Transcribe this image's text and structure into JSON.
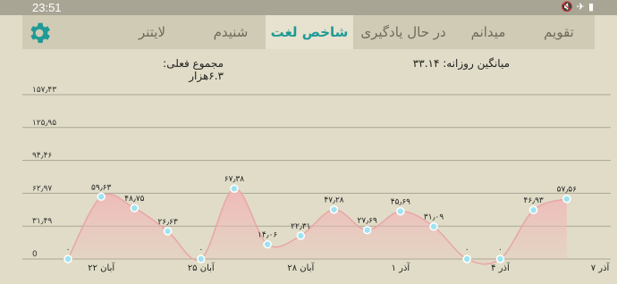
{
  "status": {
    "time": "23:51",
    "icons": [
      "mute-icon",
      "airplane-icon",
      "battery-icon"
    ],
    "icon_glyphs": "🔇✈▮"
  },
  "tabs": [
    {
      "label": "تقویم"
    },
    {
      "label": "میدانم"
    },
    {
      "label": "در حال یادگیری"
    },
    {
      "label": "شاخص لغت"
    },
    {
      "label": "شنیدم"
    },
    {
      "label": "لایتنر"
    }
  ],
  "summary": {
    "daily_average": "میانگین روزانه: ۳۳.۱۴",
    "total": "مجموع فعلی: ۶.۳هزار"
  },
  "colors": {
    "accent": "#1f9a96",
    "line": "#e8a6a6",
    "fill": "#f0b8b8",
    "point": "#9fe3f2",
    "point_stroke": "#ffffff"
  },
  "chart_data": {
    "type": "area",
    "y_ticks": [
      "0",
      "۳۱٫۴۹",
      "۶۲٫۹۷",
      "۹۴٫۴۶",
      "۱۲۵٫۹۵",
      "۱۵۷٫۴۳"
    ],
    "y_tick_values": [
      0,
      31.49,
      62.97,
      94.46,
      125.95,
      157.43
    ],
    "ylim": [
      0,
      157.43
    ],
    "x_ticks": [
      {
        "label": "۲۲ آبان",
        "x": 2
      },
      {
        "label": "۲۵ آبان",
        "x": 5
      },
      {
        "label": "۲۸ آبان",
        "x": 8
      },
      {
        "label": "۱ آذر",
        "x": 11
      },
      {
        "label": "۴ آذر",
        "x": 14
      },
      {
        "label": "۷ آذر",
        "x": 17
      }
    ],
    "xlim": [
      1,
      17
    ],
    "points": [
      {
        "x": 1,
        "y": 0,
        "label": "۰"
      },
      {
        "x": 2,
        "y": 59.63,
        "label": "۵۹٫۶۳"
      },
      {
        "x": 3,
        "y": 48.75,
        "label": "۴۸٫۷۵"
      },
      {
        "x": 4,
        "y": 26.63,
        "label": "۲۶٫۶۳"
      },
      {
        "x": 5,
        "y": 0,
        "label": "۰"
      },
      {
        "x": 6,
        "y": 67.38,
        "label": "۶۷٫۳۸"
      },
      {
        "x": 7,
        "y": 14.06,
        "label": "۱۴٫۰۶"
      },
      {
        "x": 8,
        "y": 22.31,
        "label": "۲۲٫۳۱"
      },
      {
        "x": 9,
        "y": 47.28,
        "label": "۴۷٫۲۸"
      },
      {
        "x": 10,
        "y": 27.69,
        "label": "۲۷٫۶۹"
      },
      {
        "x": 11,
        "y": 45.69,
        "label": "۴۵٫۶۹"
      },
      {
        "x": 12,
        "y": 31.09,
        "label": "۳۱٫۰۹"
      },
      {
        "x": 13,
        "y": 0,
        "label": "۰"
      },
      {
        "x": 14,
        "y": 0,
        "label": "۰"
      },
      {
        "x": 15,
        "y": 46.93,
        "label": "۴۶٫۹۳"
      },
      {
        "x": 16,
        "y": 57.56,
        "label": "۵۷٫۵۶"
      }
    ],
    "grid": true
  }
}
